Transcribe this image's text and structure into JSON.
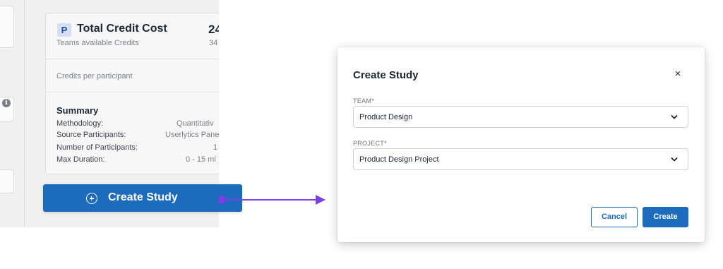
{
  "background": {
    "credit_card": {
      "badge": "P",
      "title": "Total Credit Cost",
      "subtitle": "Teams available Credits",
      "value": "24",
      "value_sub": "34",
      "per_participant_label": "Credits per participant"
    },
    "summary": {
      "title": "Summary",
      "rows": [
        {
          "key": "Methodology:",
          "value": "Quantitativ"
        },
        {
          "key": "Source Participants:",
          "value": "Userlytics Pane"
        },
        {
          "key": "Number of Participants:",
          "value": "1"
        },
        {
          "key": "Max Duration:",
          "value": "0 - 15 mi"
        }
      ]
    },
    "create_button_label": "Create Study",
    "info_icon": "i"
  },
  "modal": {
    "title": "Create Study",
    "close_icon": "×",
    "team": {
      "label": "TEAM*",
      "value": "Product Design"
    },
    "project": {
      "label": "PROJECT*",
      "value": "Product Design Project"
    },
    "cancel_label": "Cancel",
    "create_label": "Create"
  },
  "colors": {
    "primary": "#1d6bbd",
    "arrow": "#7b3fe4"
  }
}
